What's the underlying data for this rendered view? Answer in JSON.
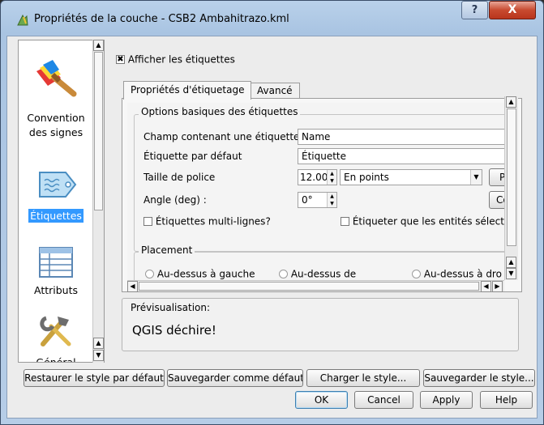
{
  "window": {
    "title": "Propriétés de la couche - CSB2 Ambahitrazo.kml",
    "help_label": "?",
    "close_label": "X"
  },
  "sidebar": {
    "items": [
      {
        "label": "Convention des signes",
        "icon": "brush-icon",
        "selected": false
      },
      {
        "label": "Étiquettes",
        "icon": "label-tag-icon",
        "selected": true
      },
      {
        "label": "Attributs",
        "icon": "table-icon",
        "selected": false
      },
      {
        "label": "Général",
        "icon": "tools-icon",
        "selected": false
      }
    ]
  },
  "show_labels": {
    "label": "Afficher les étiquettes",
    "checked": true
  },
  "tabs": [
    {
      "label": "Propriétés d'étiquetage",
      "active": true
    },
    {
      "label": "Avancé",
      "active": false
    }
  ],
  "basic": {
    "group_title": "Options basiques des étiquettes",
    "field_label": "Champ contenant une étiquette",
    "field_value": "Name",
    "default_label": "Étiquette par défaut",
    "default_value": "Étiquette",
    "font_size_label": "Taille de police",
    "font_size_value": "12.00",
    "font_unit_value": "En points",
    "font_button_label": "P",
    "angle_label": "Angle (deg) :",
    "angle_value": "0°",
    "color_button_label": "Co",
    "multiline_label": "Étiquettes multi-lignes?",
    "selected_only_label": "Étiqueter que les entités sélectio"
  },
  "placement": {
    "group_title": "Placement",
    "options": [
      "Au-dessus à gauche",
      "Au-dessus de",
      "Au-dessus à dro"
    ]
  },
  "preview": {
    "title": "Prévisualisation:",
    "text": "QGIS déchire!"
  },
  "style_buttons": {
    "restore": "Restaurer le style par défaut",
    "save_default": "Sauvegarder comme défaut",
    "load": "Charger le style...",
    "save": "Sauvegarder le style..."
  },
  "dialog_buttons": {
    "ok": "OK",
    "cancel": "Cancel",
    "apply": "Apply",
    "help": "Help"
  },
  "colors": {
    "titlebar": "#b9d1ea",
    "close_button": "#c84a2f",
    "selected_item": "#3399ff"
  }
}
